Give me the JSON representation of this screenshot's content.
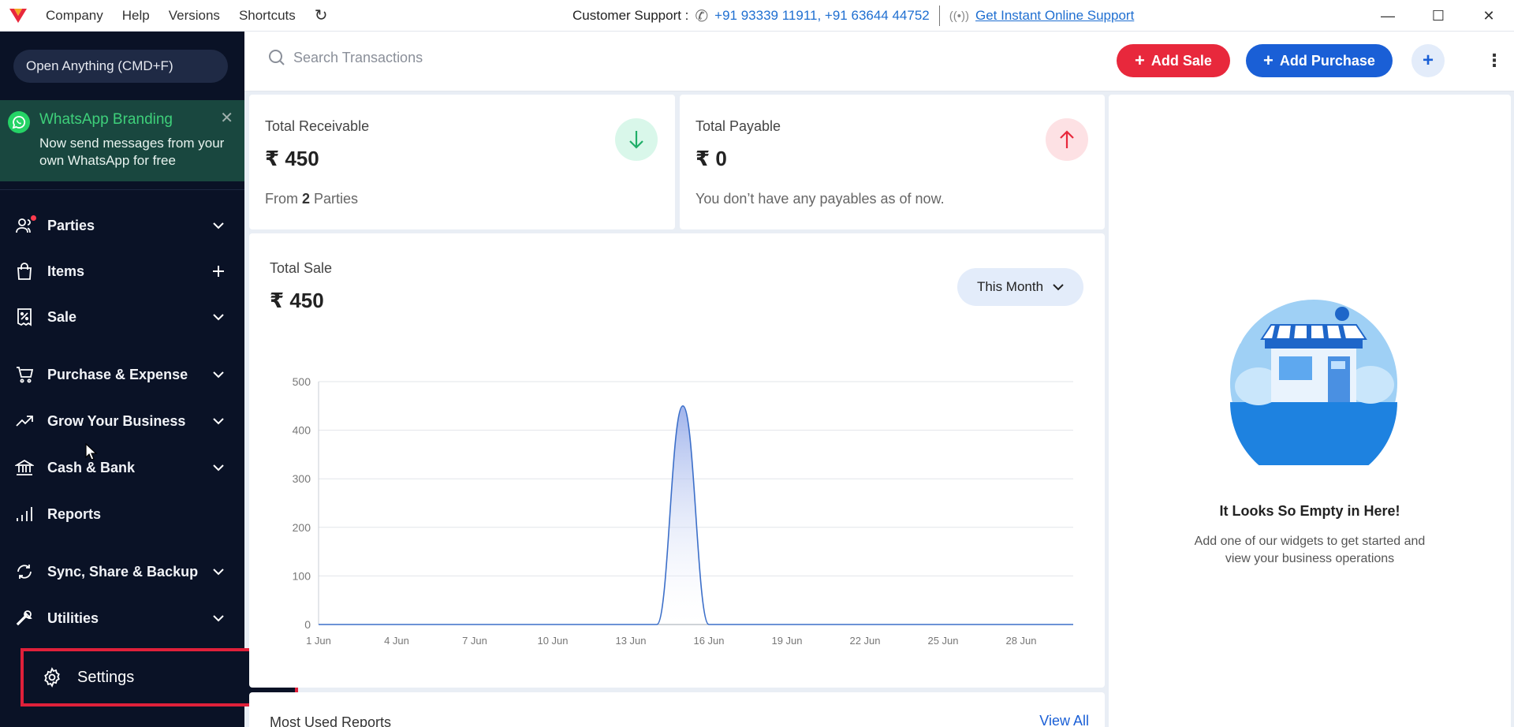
{
  "titlebar": {
    "menu": [
      "Company",
      "Help",
      "Versions",
      "Shortcuts"
    ],
    "support_label": "Customer Support :",
    "support_phones": "+91 93339 11911, +91 63644 44752",
    "online_support": "Get Instant Online Support"
  },
  "sidebar": {
    "open_anything": "Open Anything (CMD+F)",
    "whatsapp": {
      "title": "WhatsApp Branding",
      "text": "Now send messages from your own WhatsApp for free"
    },
    "items": [
      {
        "label": "Parties",
        "icon": "users-icon",
        "action": "chevron-down-icon",
        "dot": true
      },
      {
        "label": "Items",
        "icon": "bag-icon",
        "action": "plus-icon"
      },
      {
        "label": "Sale",
        "icon": "receipt-icon",
        "action": "chevron-down-icon"
      },
      {
        "label": "Purchase & Expense",
        "icon": "cart-icon",
        "action": "chevron-down-icon"
      },
      {
        "label": "Grow Your Business",
        "icon": "trend-up-icon",
        "action": "chevron-down-icon"
      },
      {
        "label": "Cash & Bank",
        "icon": "bank-icon",
        "action": "chevron-down-icon"
      },
      {
        "label": "Reports",
        "icon": "bar-chart-icon",
        "action": ""
      },
      {
        "label": "Sync, Share & Backup",
        "icon": "sync-icon",
        "action": "chevron-down-icon"
      },
      {
        "label": "Utilities",
        "icon": "wrench-icon",
        "action": "chevron-down-icon"
      }
    ],
    "settings": "Settings"
  },
  "topbar": {
    "search_placeholder": "Search Transactions",
    "add_sale": "Add Sale",
    "add_purchase": "Add Purchase"
  },
  "receivable": {
    "label": "Total Receivable",
    "amount": "₹ 450",
    "foot_prefix": "From ",
    "foot_count": "2",
    "foot_suffix": " Parties"
  },
  "payable": {
    "label": "Total Payable",
    "amount": "₹ 0",
    "foot": "You don’t have any payables as of now."
  },
  "sale": {
    "label": "Total Sale",
    "amount": "₹ 450",
    "period": "This Month"
  },
  "reports": {
    "title": "Most Used Reports",
    "view_all": "View All"
  },
  "empty": {
    "title": "It Looks So Empty in Here!",
    "text": "Add one of our widgets to get started and view your business operations"
  },
  "colors": {
    "accent_blue": "#1a5fd6",
    "accent_red": "#e8283c",
    "sidebar_bg": "#0a1226",
    "whatsapp_green": "#3ed07a"
  },
  "chart_data": {
    "type": "area",
    "x_ticks": [
      "1 Jun",
      "4 Jun",
      "7 Jun",
      "10 Jun",
      "13 Jun",
      "16 Jun",
      "19 Jun",
      "22 Jun",
      "25 Jun",
      "28 Jun"
    ],
    "y_ticks": [
      0,
      100,
      200,
      300,
      400,
      500
    ],
    "ylim": [
      0,
      500
    ],
    "x": [
      1,
      2,
      3,
      4,
      5,
      6,
      7,
      8,
      9,
      10,
      11,
      12,
      13,
      14,
      15,
      16,
      17,
      18,
      19,
      20,
      21,
      22,
      23,
      24,
      25,
      26,
      27,
      28,
      29,
      30
    ],
    "values": [
      0,
      0,
      0,
      0,
      0,
      0,
      0,
      0,
      0,
      0,
      0,
      0,
      0,
      0,
      450,
      0,
      0,
      0,
      0,
      0,
      0,
      0,
      0,
      0,
      0,
      0,
      0,
      0,
      0,
      0
    ],
    "grid": true
  }
}
